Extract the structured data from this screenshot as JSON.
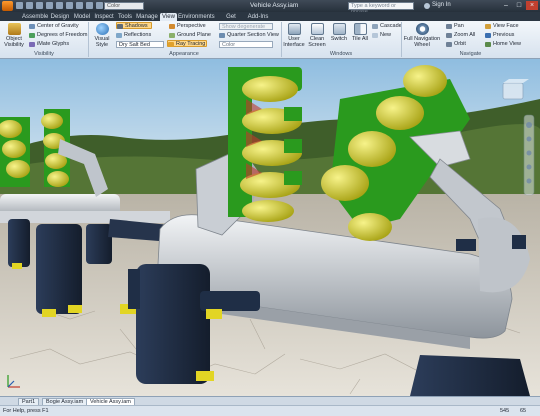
{
  "titlebar": {
    "color_box": "Color",
    "title": "Vehicle Assy.iam",
    "search_placeholder": "Type a keyword or phrase",
    "sign_in": "Sign In"
  },
  "tabs": [
    "Assemble",
    "Design",
    "Model",
    "Inspect",
    "Tools",
    "Manage",
    "View",
    "Environments",
    "Get Started",
    "Add-Ins"
  ],
  "active_tab": "View",
  "ribbon": {
    "visibility": {
      "object_visibility": "Object Visibility",
      "center_of_gravity": "Center of Gravity",
      "degrees_of_freedom": "Degrees of Freedom",
      "imate_glyphs": "iMate Glyphs",
      "label": "Visibility"
    },
    "appearance": {
      "visual_style": "Visual Style",
      "shadows": "Shadows",
      "reflections": "Reflections",
      "scene": "Dry Salt Bed",
      "perspective": "Perspective",
      "ground_plane": "Ground Plane",
      "ray_tracing": "Ray Tracing",
      "show_dropdown": "Show degenerate",
      "quarter_section_view": "Quarter Section View",
      "color_dropdown": "Color",
      "label": "Appearance"
    },
    "windows": {
      "user_interface": "User Interface",
      "clean_screen": "Clean Screen",
      "switch": "Switch",
      "tile_all": "Tile All",
      "cascade": "Cascade",
      "new": "New",
      "label": "Windows"
    },
    "navigate": {
      "full_navigation_wheel": "Full Navigation Wheel",
      "pan": "Pan",
      "zoom_all": "Zoom All",
      "orbit": "Orbit",
      "view_face": "View Face",
      "previous": "Previous",
      "home_view": "Home View",
      "label": "Navigate"
    }
  },
  "document_tabs": [
    "Part1",
    "Bogie Assy.iam",
    "Vehicle Assy.iam"
  ],
  "active_document_tab": "Vehicle Assy.iam",
  "status": {
    "help": "For Help, press F1",
    "count_a": "545",
    "count_b": "65"
  },
  "colors": {
    "accent": "#ffd88a",
    "titlebar": "#2b3642",
    "ribbon": "#e3ebf4",
    "green_part": "#2a9a1e",
    "yellow_part": "#d6d323",
    "steel": "#c9ced4",
    "navy_part": "#1f2e46"
  },
  "icons": {
    "app_menu": "inventor-app-icon",
    "viewcube": "viewcube-icon",
    "nav_bar": "navigation-bar-icon"
  }
}
